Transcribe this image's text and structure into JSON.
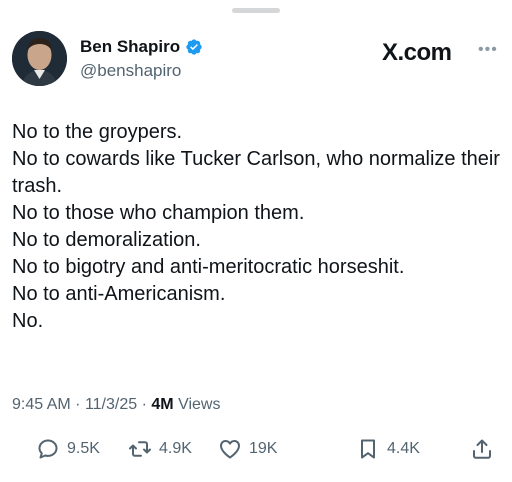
{
  "author": {
    "name": "Ben Shapiro",
    "handle": "@benshapiro"
  },
  "brand": "X.com",
  "more_icon": "more-icon",
  "body_lines": [
    "No to the groypers.",
    "No to cowards like Tucker Carlson, who normalize their trash.",
    "No to those who champion them.",
    "No to demoralization.",
    "No to bigotry and anti-meritocratic horseshit.",
    "No to anti-Americanism.",
    "No."
  ],
  "meta": {
    "time": "9:45 AM",
    "date": "11/3/25",
    "sep": "·",
    "views_count": "4M",
    "views_label": "Views"
  },
  "actions": {
    "replies": "9.5K",
    "reposts": "4.9K",
    "likes": "19K",
    "bookmarks": "4.4K"
  },
  "colors": {
    "verified": "#1d9bf0",
    "text": "#0f1419",
    "secondary": "#536471"
  }
}
